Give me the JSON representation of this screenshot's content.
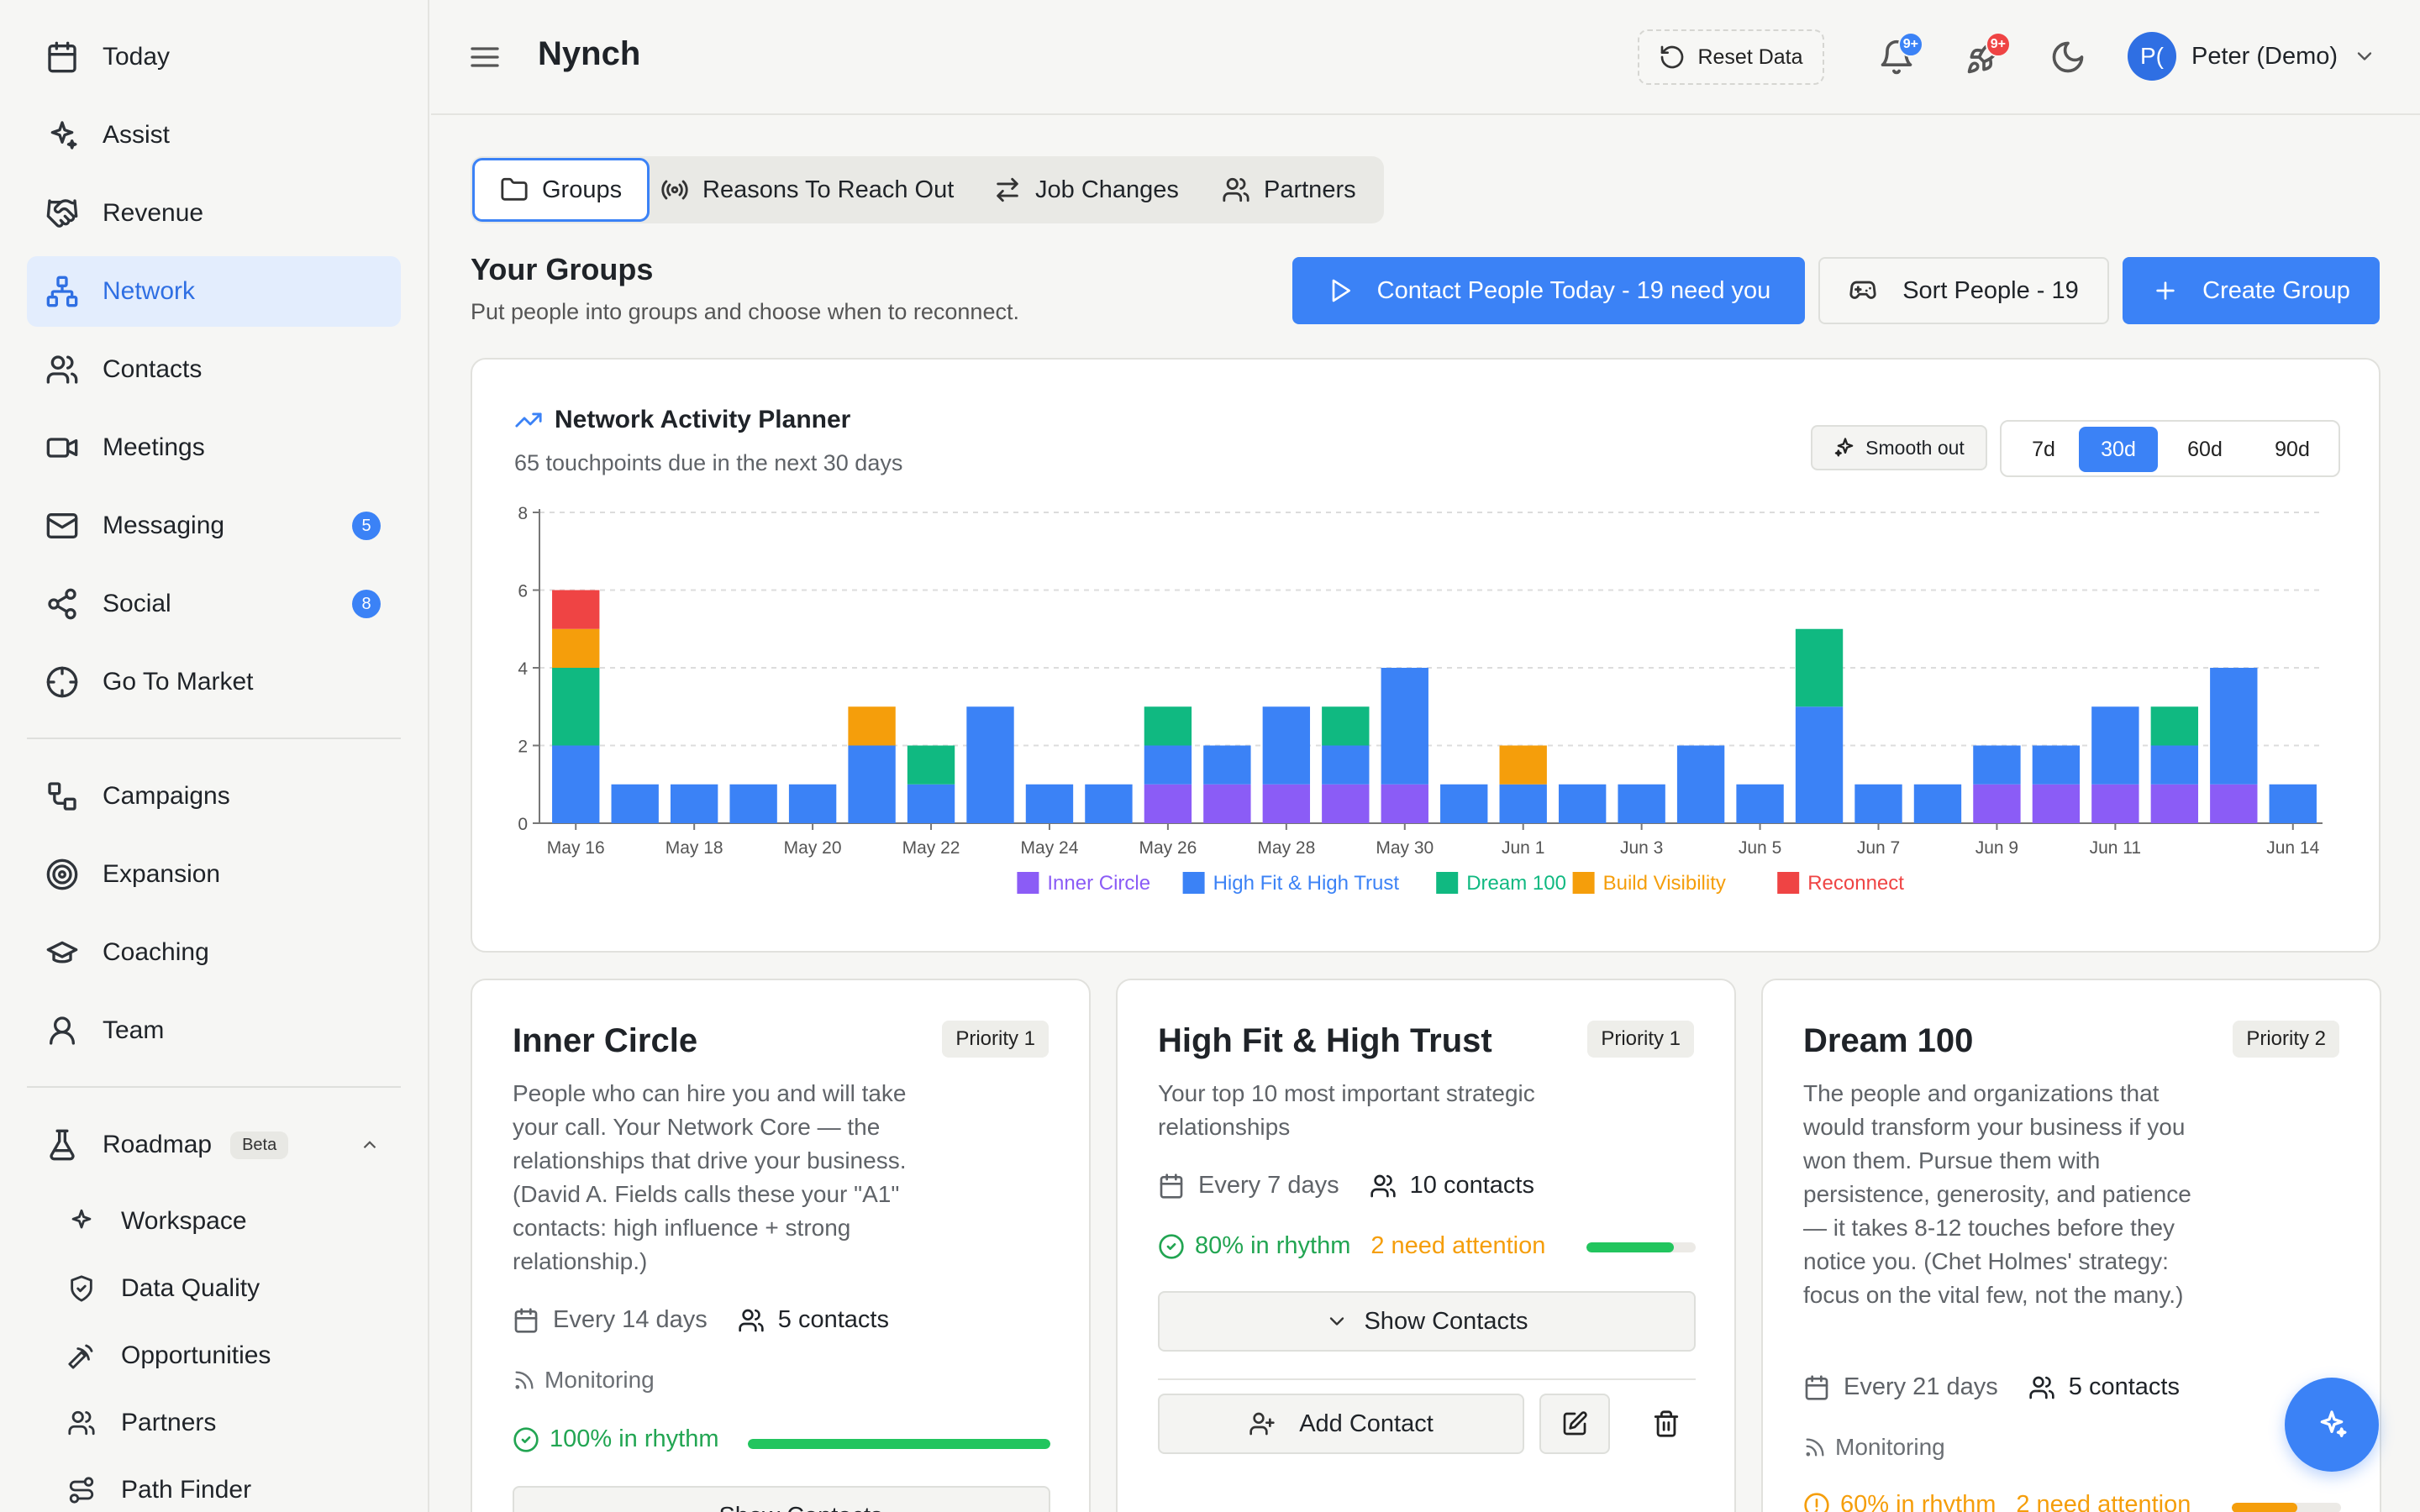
{
  "app": {
    "title": "Nynch"
  },
  "sidebar": {
    "items": [
      {
        "label": "Today",
        "icon": "calendar-icon"
      },
      {
        "label": "Assist",
        "icon": "sparkles-icon"
      },
      {
        "label": "Revenue",
        "icon": "handshake-icon"
      },
      {
        "label": "Network",
        "icon": "network-icon",
        "active": true
      },
      {
        "label": "Contacts",
        "icon": "users-icon"
      },
      {
        "label": "Meetings",
        "icon": "video-icon"
      },
      {
        "label": "Messaging",
        "icon": "mail-icon",
        "badge": "5"
      },
      {
        "label": "Social",
        "icon": "share-icon",
        "badge": "8"
      },
      {
        "label": "Go To Market",
        "icon": "globe-icon"
      }
    ],
    "items2": [
      {
        "label": "Campaigns",
        "icon": "campaign-icon"
      },
      {
        "label": "Expansion",
        "icon": "target-icon"
      },
      {
        "label": "Coaching",
        "icon": "graduation-cap-icon"
      },
      {
        "label": "Team",
        "icon": "user-icon"
      }
    ],
    "roadmap": {
      "label": "Roadmap",
      "badge": "Beta",
      "items": [
        {
          "label": "Workspace",
          "icon": "sparkles-icon"
        },
        {
          "label": "Data Quality",
          "icon": "shield-check-icon"
        },
        {
          "label": "Opportunities",
          "icon": "pickaxe-icon"
        },
        {
          "label": "Partners",
          "icon": "users-icon"
        },
        {
          "label": "Path Finder",
          "icon": "route-icon"
        }
      ]
    }
  },
  "topbar": {
    "reset_label": "Reset Data",
    "notifications_badge": "9+",
    "rocket_badge": "9+",
    "user_initials": "P(",
    "user_name": "Peter (Demo)"
  },
  "tabs": [
    {
      "label": "Groups",
      "active": true
    },
    {
      "label": "Reasons To Reach Out"
    },
    {
      "label": "Job Changes"
    },
    {
      "label": "Partners"
    }
  ],
  "groups_section": {
    "title": "Your Groups",
    "subtitle": "Put people into groups and choose when to reconnect.",
    "contact_today": "Contact People Today - 19 need you",
    "sort_people": "Sort People - 19",
    "create_group": "Create Group"
  },
  "planner": {
    "title": "Network Activity Planner",
    "subtitle": "65 touchpoints due in the next 30 days",
    "smooth_label": "Smooth out",
    "ranges": [
      "7d",
      "30d",
      "60d",
      "90d"
    ],
    "active_range": "30d"
  },
  "chart_data": {
    "type": "bar",
    "stacked": true,
    "ylim": [
      0,
      8
    ],
    "yticks": [
      0,
      2,
      4,
      6,
      8
    ],
    "grid": true,
    "legend_position": "bottom",
    "categories": [
      "May 16",
      "May 17",
      "May 18",
      "May 19",
      "May 20",
      "May 21",
      "May 22",
      "May 23",
      "May 24",
      "May 25",
      "May 26",
      "May 27",
      "May 28",
      "May 29",
      "May 30",
      "May 31",
      "Jun 1",
      "Jun 2",
      "Jun 3",
      "Jun 4",
      "Jun 5",
      "Jun 6",
      "Jun 7",
      "Jun 8",
      "Jun 9",
      "Jun 10",
      "Jun 11",
      "Jun 12",
      "Jun 13",
      "Jun 14"
    ],
    "tick_labels": [
      "May 16",
      "May 18",
      "May 20",
      "May 22",
      "May 24",
      "May 26",
      "May 28",
      "May 30",
      "Jun 1",
      "Jun 3",
      "Jun 5",
      "Jun 7",
      "Jun 9",
      "Jun 11",
      "Jun 14"
    ],
    "series": [
      {
        "name": "Inner Circle",
        "color": "#8b5cf6",
        "values": [
          0,
          0,
          0,
          0,
          0,
          0,
          0,
          0,
          0,
          0,
          1,
          1,
          1,
          1,
          1,
          0,
          0,
          0,
          0,
          0,
          0,
          0,
          0,
          0,
          1,
          1,
          1,
          1,
          1,
          0
        ]
      },
      {
        "name": "High Fit & High Trust",
        "color": "#3b82f6",
        "values": [
          2,
          1,
          1,
          1,
          1,
          2,
          1,
          3,
          1,
          1,
          1,
          1,
          2,
          1,
          3,
          1,
          1,
          1,
          1,
          2,
          1,
          3,
          1,
          1,
          1,
          1,
          2,
          1,
          3,
          1
        ]
      },
      {
        "name": "Dream 100",
        "color": "#10b981",
        "values": [
          2,
          0,
          0,
          0,
          0,
          0,
          1,
          0,
          0,
          0,
          1,
          0,
          0,
          1,
          0,
          0,
          0,
          0,
          0,
          0,
          0,
          2,
          0,
          0,
          0,
          0,
          0,
          1,
          0,
          0
        ]
      },
      {
        "name": "Build Visibility",
        "color": "#f59e0b",
        "values": [
          1,
          0,
          0,
          0,
          0,
          1,
          0,
          0,
          0,
          0,
          0,
          0,
          0,
          0,
          0,
          0,
          1,
          0,
          0,
          0,
          0,
          0,
          0,
          0,
          0,
          0,
          0,
          0,
          0,
          0
        ]
      },
      {
        "name": "Reconnect",
        "color": "#ef4444",
        "values": [
          1,
          0,
          0,
          0,
          0,
          0,
          0,
          0,
          0,
          0,
          0,
          0,
          0,
          0,
          0,
          0,
          0,
          0,
          0,
          0,
          0,
          0,
          0,
          0,
          0,
          0,
          0,
          0,
          0,
          0
        ]
      }
    ]
  },
  "groups": [
    {
      "title": "Inner Circle",
      "priority": "Priority 1",
      "description": "People who can hire you and will take your call. Your Network Core — the relationships that drive your business. (David A. Fields calls these your \"A1\" contacts: high influence + strong relationship.)",
      "cadence": "Every 14 days",
      "contacts": "5 contacts",
      "monitoring": "Monitoring",
      "rhythm": "100% in rhythm",
      "attention": "",
      "progress": 1.0,
      "show_contacts": "Show Contacts"
    },
    {
      "title": "High Fit & High Trust",
      "priority": "Priority 1",
      "description": "Your top 10 most important strategic relationships",
      "cadence": "Every 7 days",
      "contacts": "10 contacts",
      "rhythm": "80% in rhythm",
      "attention": "2 need attention",
      "progress": 0.8,
      "show_contacts": "Show Contacts",
      "add_contact": "Add Contact"
    },
    {
      "title": "Dream 100",
      "priority": "Priority 2",
      "description": "The people and organizations that would transform your business if you won them. Pursue them with persistence, generosity, and patience — it takes 8-12 touches before they notice you. (Chet Holmes' strategy: focus on the vital few, not the many.)",
      "cadence": "Every 21 days",
      "contacts": "5 contacts",
      "monitoring": "Monitoring",
      "rhythm": "60% in rhythm",
      "attention": "2 need attention",
      "progress": 0.6
    }
  ]
}
